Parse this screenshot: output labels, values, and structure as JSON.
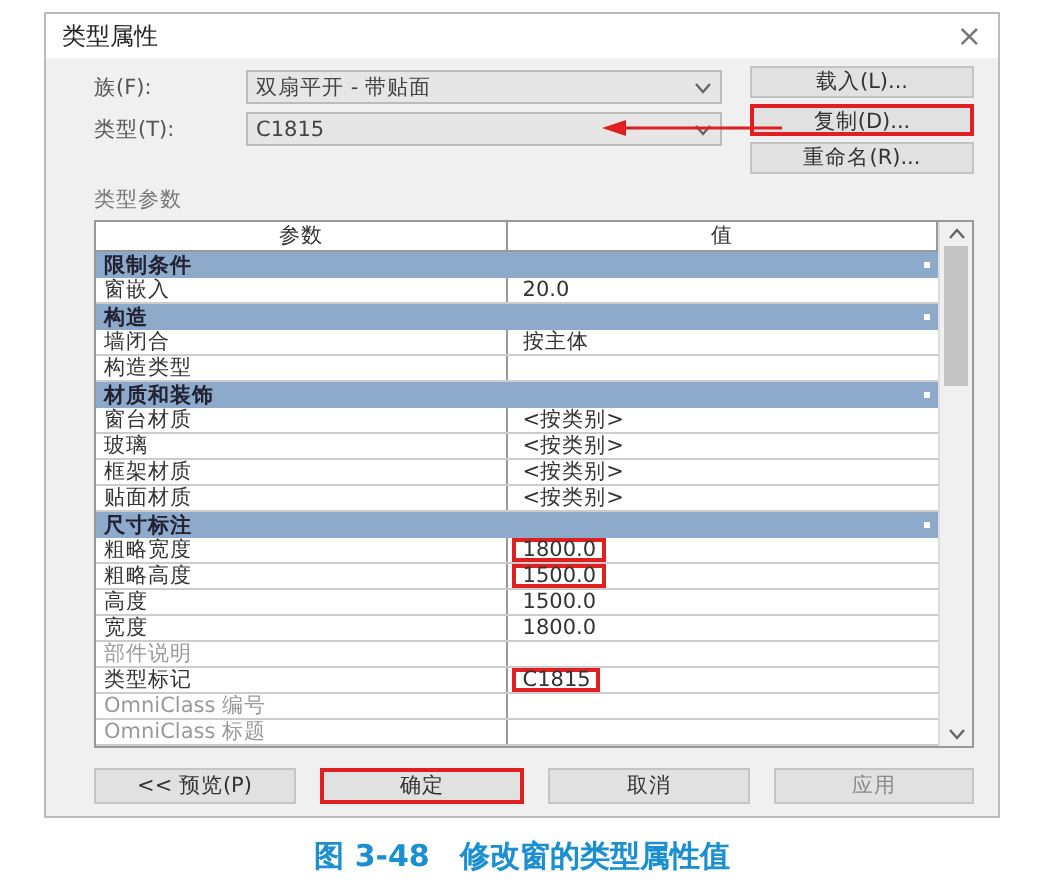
{
  "window": {
    "title": "类型属性",
    "close": "×"
  },
  "fields": [
    {
      "label": "族(F):",
      "value": "双扇平开 - 带贴面"
    },
    {
      "label": "类型(T):",
      "value": "C1815"
    }
  ],
  "side_buttons": [
    {
      "label": "载入(L)...",
      "highlighted": false
    },
    {
      "label": "复制(D)...",
      "highlighted": true
    },
    {
      "label": "重命名(R)..."
    }
  ],
  "section_label": "类型参数",
  "table": {
    "columns": [
      "参数",
      "值"
    ],
    "rows": [
      {
        "kind": "group",
        "name": "限制条件"
      },
      {
        "kind": "param",
        "name": "窗嵌入",
        "value": "20.0",
        "highlighted": false,
        "disabled": false
      },
      {
        "kind": "group",
        "name": "构造"
      },
      {
        "kind": "param",
        "name": "墙闭合",
        "value": "按主体",
        "highlighted": false,
        "disabled": false
      },
      {
        "kind": "param",
        "name": "构造类型",
        "disabled": false
      },
      {
        "kind": "group",
        "name": "材质和装饰"
      },
      {
        "kind": "param",
        "name": "窗台材质",
        "value": "<按类别>",
        "highlighted": false,
        "disabled": false
      },
      {
        "kind": "param",
        "name": "玻璃",
        "value": "<按类别>",
        "highlighted": false,
        "disabled": false
      },
      {
        "kind": "param",
        "name": "框架材质",
        "value": "<按类别>",
        "highlighted": false,
        "disabled": false
      },
      {
        "kind": "param",
        "name": "贴面材质",
        "value": "<按类别>",
        "highlighted": false,
        "disabled": false
      },
      {
        "kind": "group",
        "name": "尺寸标注"
      },
      {
        "kind": "param",
        "name": "粗略宽度",
        "value": "1800.0",
        "highlighted": true,
        "disabled": false
      },
      {
        "kind": "param",
        "name": "粗略高度",
        "value": "1500.0",
        "highlighted": true,
        "disabled": false
      },
      {
        "kind": "param",
        "name": "高度",
        "value": "1500.0",
        "highlighted": false,
        "disabled": false
      },
      {
        "kind": "param",
        "name": "宽度",
        "value": "1800.0",
        "highlighted": false,
        "disabled": false
      },
      {
        "kind": "param",
        "name": "部件说明",
        "disabled": true
      },
      {
        "kind": "param",
        "name": "类型标记",
        "value": "C1815",
        "highlighted": true,
        "disabled": false
      },
      {
        "kind": "param",
        "name": "OmniClass 编号",
        "disabled": true
      },
      {
        "kind": "param",
        "name": "OmniClass 标题",
        "disabled": true
      }
    ]
  },
  "bottom_buttons": [
    {
      "label": "<< 预览(P)",
      "highlighted": false,
      "disabled": false
    },
    {
      "label": "确定",
      "highlighted": true,
      "disabled": false
    },
    {
      "label": "取消",
      "highlighted": false,
      "disabled": false
    },
    {
      "label": "应用",
      "highlighted": false,
      "disabled": true
    }
  ],
  "caption": "图 3-48　修改窗的类型属性值"
}
